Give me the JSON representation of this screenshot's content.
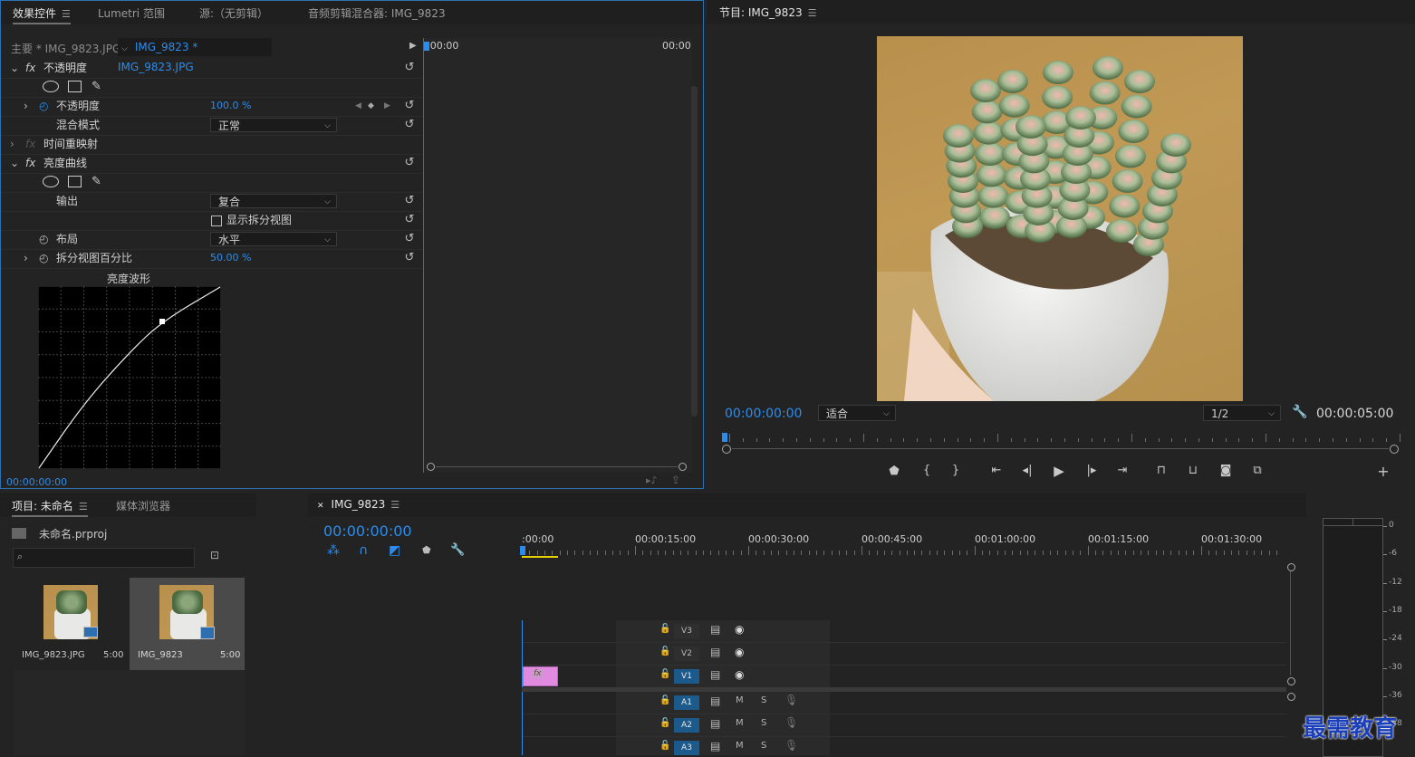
{
  "effect_controls": {
    "tabs": [
      "效果控件",
      "Lumetri 范围",
      "源:（无剪辑）",
      "音频剪辑混合器: IMG_9823"
    ],
    "master_label": "主要 * IMG_9823.JPG",
    "clip_label": "IMG_9823 * IMG_9823.JPG",
    "time_left": ":00:00",
    "time_right": "00:00",
    "opacity_fx": "不透明度",
    "opacity_param": "不透明度",
    "opacity_value": "100.0 %",
    "blend_mode_label": "混合模式",
    "blend_mode_value": "正常",
    "time_remap": "时间重映射",
    "luma_curve": "亮度曲线",
    "output_label": "输出",
    "output_value": "复合",
    "show_split_label": "显示拆分视图",
    "layout_label": "布局",
    "layout_value": "水平",
    "split_pct_label": "拆分视图百分比",
    "split_pct_value": "50.00 %",
    "waveform_title": "亮度波形",
    "timecode": "00:00:00:00",
    "fx_glyph": "fx"
  },
  "program": {
    "title": "节目: IMG_9823",
    "timecode": "00:00:00:00",
    "fit_value": "适合",
    "resolution_value": "1/2",
    "duration": "00:00:05:00"
  },
  "project": {
    "tabs": [
      "项目: 未命名",
      "媒体浏览器"
    ],
    "project_file": "未命名.prproj",
    "items": [
      {
        "name": "IMG_9823.JPG",
        "duration": "5:00"
      },
      {
        "name": "IMG_9823",
        "duration": "5:00"
      }
    ]
  },
  "timeline": {
    "tab": "IMG_9823",
    "timecode": "00:00:00:00",
    "ruler_labels": [
      ":00:00",
      "00:00:15:00",
      "00:00:30:00",
      "00:00:45:00",
      "00:01:00:00",
      "00:01:15:00",
      "00:01:30:00"
    ],
    "video_tracks": [
      "V3",
      "V2",
      "V1"
    ],
    "audio_tracks": [
      "A1",
      "A2",
      "A3"
    ],
    "mute_label": "M",
    "solo_label": "S",
    "clip_fx": "fx"
  },
  "meter": {
    "scale": [
      "0",
      "-6",
      "-12",
      "-18",
      "-24",
      "-30",
      "-36",
      "-48"
    ]
  },
  "watermark": "最需教育",
  "colors": {
    "accent_blue": "#2d8ceb",
    "clip_pink": "#d67ad6",
    "background": "#232323"
  },
  "curve": {
    "points": [
      [
        0,
        0
      ],
      [
        0.25,
        0.36
      ],
      [
        0.5,
        0.64
      ],
      [
        0.68,
        0.81
      ],
      [
        1,
        1
      ]
    ]
  }
}
